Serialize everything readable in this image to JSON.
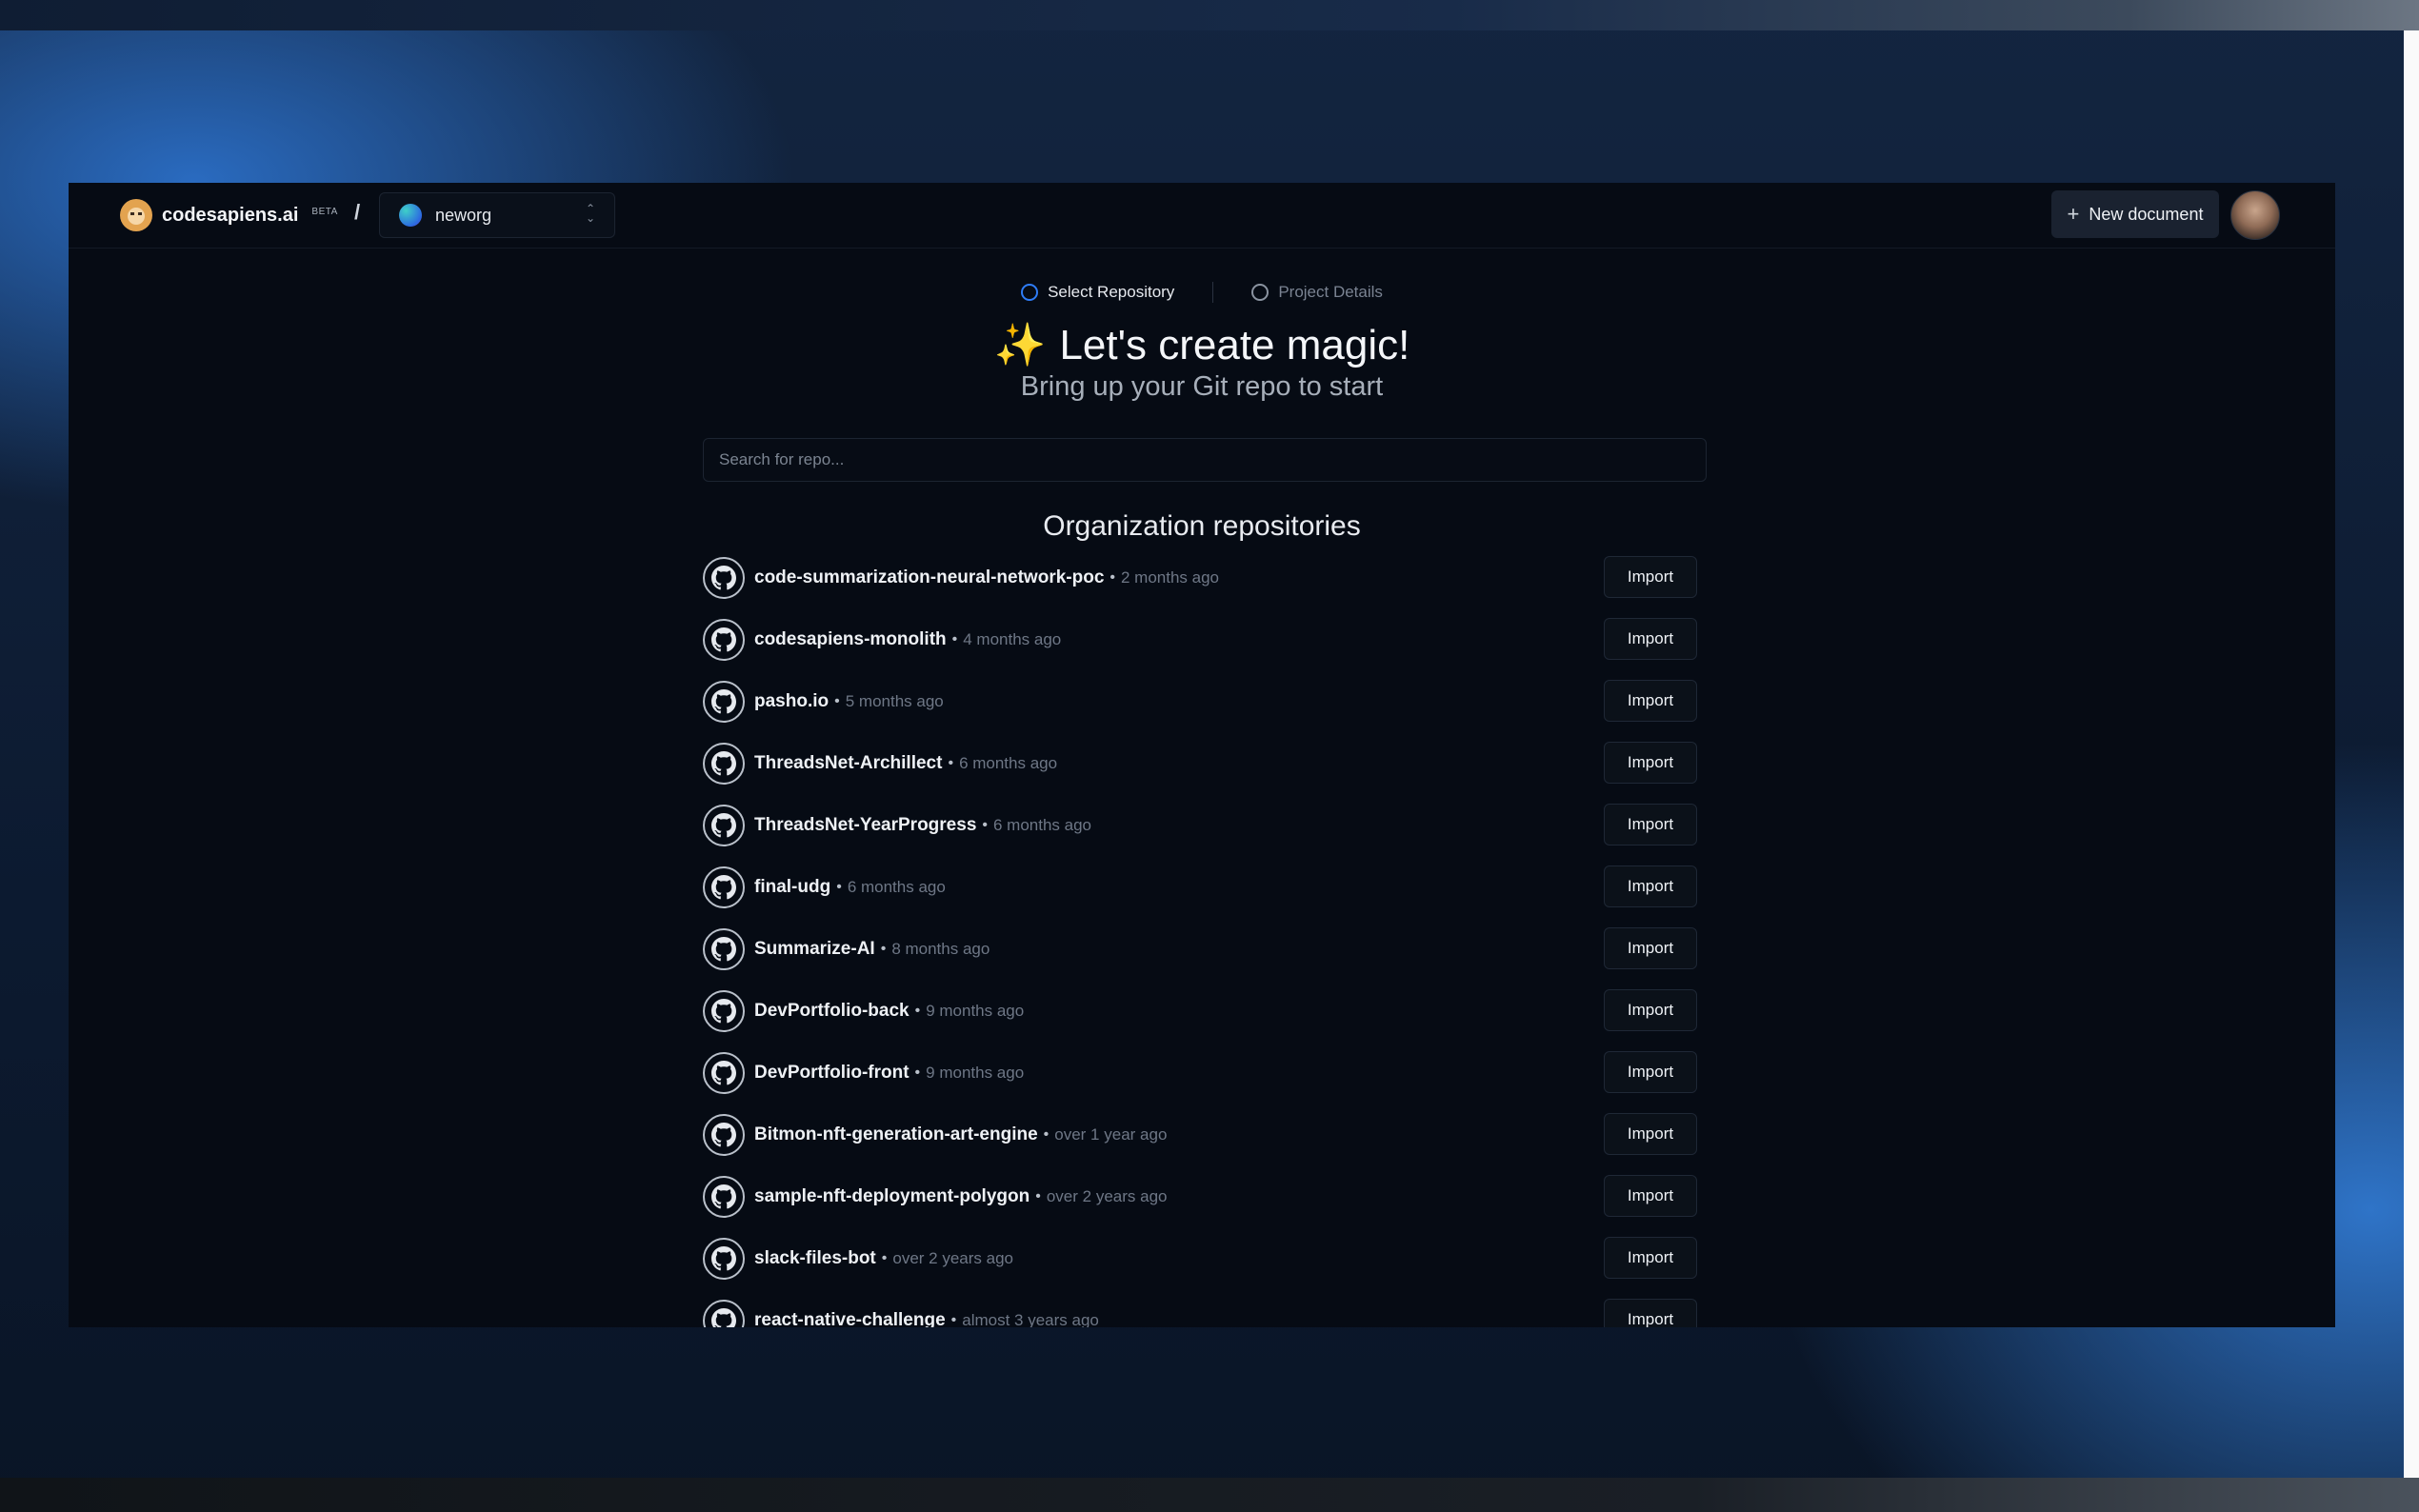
{
  "app": {
    "brand_name": "codesapiens.ai",
    "brand_badge": "BETA",
    "separator": "/",
    "org_select": {
      "value": "neworg"
    },
    "new_document_label": "New document"
  },
  "stepper": {
    "steps": [
      {
        "label": "Select Repository",
        "active": true
      },
      {
        "label": "Project Details",
        "active": false
      }
    ]
  },
  "hero": {
    "title": "Let's create magic!",
    "subtitle": "Bring up your Git repo to start"
  },
  "search": {
    "placeholder": "Search for repo..."
  },
  "repos": {
    "heading": "Organization repositories",
    "import_label": "Import",
    "items": [
      {
        "name": "code-summarization-neural-network-poc",
        "updated": "2 months ago"
      },
      {
        "name": "codesapiens-monolith",
        "updated": "4 months ago"
      },
      {
        "name": "pasho.io",
        "updated": "5 months ago"
      },
      {
        "name": "ThreadsNet-Archillect",
        "updated": "6 months ago"
      },
      {
        "name": "ThreadsNet-YearProgress",
        "updated": "6 months ago"
      },
      {
        "name": "final-udg",
        "updated": "6 months ago"
      },
      {
        "name": "Summarize-AI",
        "updated": "8 months ago"
      },
      {
        "name": "DevPortfolio-back",
        "updated": "9 months ago"
      },
      {
        "name": "DevPortfolio-front",
        "updated": "9 months ago"
      },
      {
        "name": "Bitmon-nft-generation-art-engine",
        "updated": "over 1 year ago"
      },
      {
        "name": "sample-nft-deployment-polygon",
        "updated": "over 2 years ago"
      },
      {
        "name": "slack-files-bot",
        "updated": "over 2 years ago"
      },
      {
        "name": "react-native-challenge",
        "updated": "almost 3 years ago"
      }
    ]
  },
  "colors": {
    "app_bg": "#060b14",
    "accent": "#2e7cf6",
    "text_primary": "#eef1f5",
    "text_muted": "#6e7786"
  },
  "icons": {
    "brand": "monkey-icon",
    "repo": "github-icon",
    "new_document": "plus-icon",
    "org_select": "chevron-up-down-icon",
    "title": "sparkles-icon"
  }
}
